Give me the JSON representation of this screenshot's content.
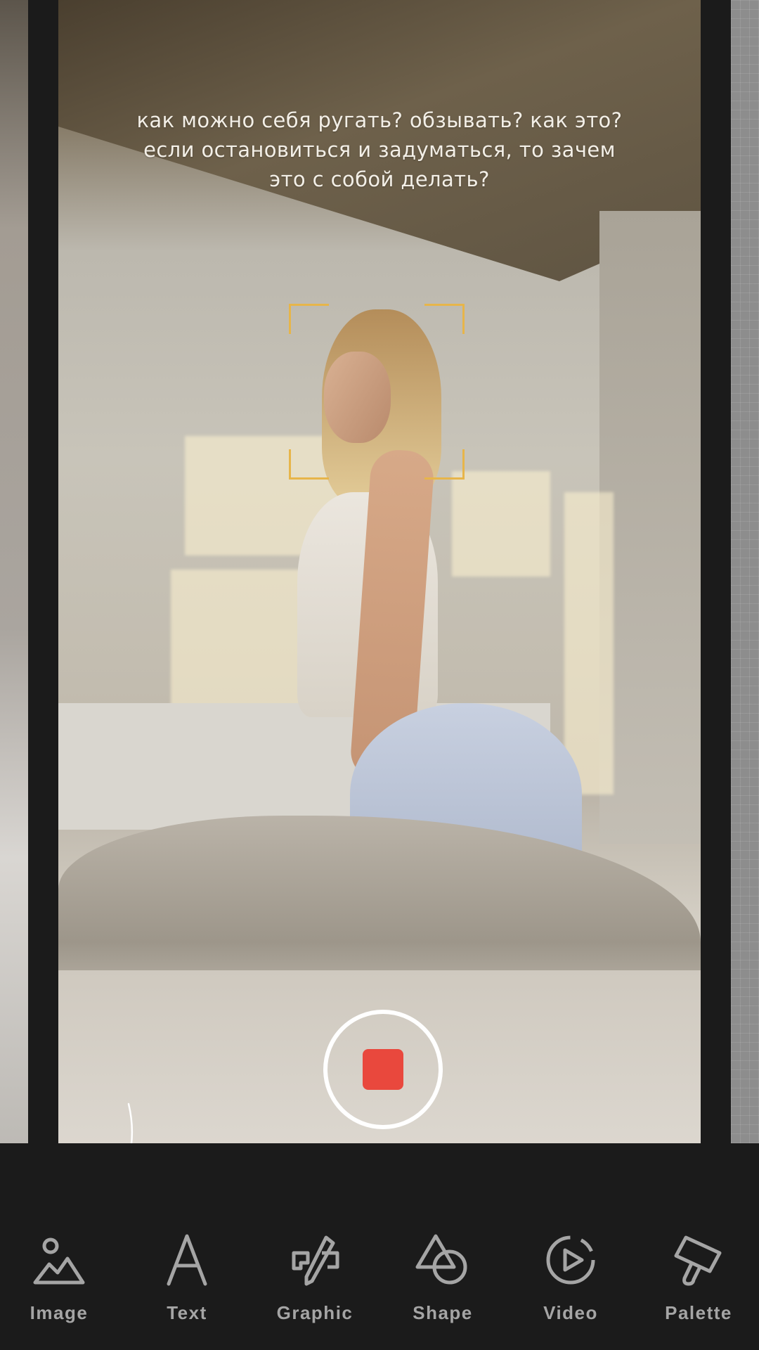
{
  "caption": {
    "line1": "как можно себя ругать? обзывать? как это?",
    "line2": "если остановиться и задуматься, то зачем",
    "line3": "это с собой делать?"
  },
  "record_button": {
    "state": "recording",
    "inner_color": "#e9483d"
  },
  "toolbar": {
    "items": [
      {
        "label": "Image",
        "icon": "image-icon"
      },
      {
        "label": "Text",
        "icon": "text-icon"
      },
      {
        "label": "Graphic",
        "icon": "graphic-icon"
      },
      {
        "label": "Shape",
        "icon": "shape-icon"
      },
      {
        "label": "Video",
        "icon": "video-icon"
      },
      {
        "label": "Palette",
        "icon": "palette-icon"
      }
    ]
  },
  "colors": {
    "background": "#1b1b1b",
    "toolbar_label": "#a5a5a5",
    "focus_frame": "#e7b54a",
    "record": "#e9483d"
  }
}
